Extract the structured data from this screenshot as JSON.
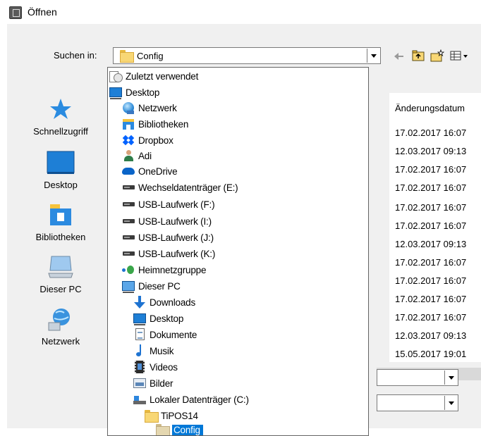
{
  "window": {
    "title": "Öffnen"
  },
  "lookin": {
    "label": "Suchen in:",
    "value": "Config"
  },
  "places": [
    {
      "label": "Schnellzugriff",
      "icon": "star-icon"
    },
    {
      "label": "Desktop",
      "icon": "desktop-icon"
    },
    {
      "label": "Bibliotheken",
      "icon": "libraries-icon"
    },
    {
      "label": "Dieser PC",
      "icon": "computer-icon"
    },
    {
      "label": "Netzwerk",
      "icon": "network-icon"
    }
  ],
  "filelist": {
    "column_header": "Änderungsdatum",
    "dates": [
      "17.02.2017 16:07",
      "12.03.2017 09:13",
      "17.02.2017 16:07",
      "17.02.2017 16:07",
      "17.02.2017 16:07",
      "17.02.2017 16:07",
      "12.03.2017 09:13",
      "17.02.2017 16:07",
      "17.02.2017 16:07",
      "17.02.2017 16:07",
      "17.02.2017 16:07",
      "12.03.2017 09:13",
      "15.05.2017 19:01"
    ]
  },
  "dropdown": {
    "items": [
      {
        "label": "Zuletzt verwendet",
        "icon": "recent-icon",
        "level": 0
      },
      {
        "label": "Desktop",
        "icon": "desktop-icon",
        "level": 0
      },
      {
        "label": "Netzwerk",
        "icon": "network-icon",
        "level": 1
      },
      {
        "label": "Bibliotheken",
        "icon": "libraries-icon",
        "level": 1
      },
      {
        "label": "Dropbox",
        "icon": "dropbox-icon",
        "level": 1
      },
      {
        "label": "Adi",
        "icon": "user-icon",
        "level": 1
      },
      {
        "label": "OneDrive",
        "icon": "onedrive-icon",
        "level": 1
      },
      {
        "label": "Wechseldatenträger (E:)",
        "icon": "removable-drive-icon",
        "level": 1
      },
      {
        "label": "USB-Laufwerk (F:)",
        "icon": "usb-drive-icon",
        "level": 1
      },
      {
        "label": "USB-Laufwerk (I:)",
        "icon": "usb-drive-icon",
        "level": 1
      },
      {
        "label": "USB-Laufwerk (J:)",
        "icon": "usb-drive-icon",
        "level": 1
      },
      {
        "label": "USB-Laufwerk (K:)",
        "icon": "usb-drive-icon",
        "level": 1
      },
      {
        "label": "Heimnetzgruppe",
        "icon": "homegroup-icon",
        "level": 1
      },
      {
        "label": "Dieser PC",
        "icon": "computer-icon",
        "level": 1
      },
      {
        "label": "Downloads",
        "icon": "downloads-icon",
        "level": 2
      },
      {
        "label": "Desktop",
        "icon": "desktop-icon",
        "level": 2
      },
      {
        "label": "Dokumente",
        "icon": "documents-icon",
        "level": 2
      },
      {
        "label": "Musik",
        "icon": "music-icon",
        "level": 2
      },
      {
        "label": "Videos",
        "icon": "videos-icon",
        "level": 2
      },
      {
        "label": "Bilder",
        "icon": "pictures-icon",
        "level": 2
      },
      {
        "label": "Lokaler Datenträger (C:)",
        "icon": "local-disk-icon",
        "level": 2
      },
      {
        "label": "TiPOS14",
        "icon": "folder-icon",
        "level": 3
      },
      {
        "label": "Config",
        "icon": "folder-icon",
        "level": 4,
        "selected": true
      }
    ]
  },
  "colors": {
    "selection": "#0078d7",
    "dialog_bg": "#f0f0f0",
    "folder": "#f8d775"
  }
}
